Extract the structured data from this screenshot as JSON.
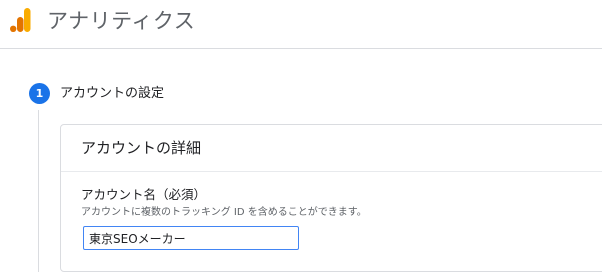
{
  "header": {
    "logo_icon": "google-analytics-logo",
    "app_title": "アナリティクス"
  },
  "step": {
    "number": "1",
    "title": "アカウントの設定"
  },
  "card": {
    "title": "アカウントの詳細",
    "field": {
      "label": "アカウント名（必須）",
      "help": "アカウントに複数のトラッキング ID を含めることができます。",
      "value": "東京SEOメーカー"
    }
  },
  "colors": {
    "accent": "#1a73e8",
    "logo_orange": "#f9ab00",
    "logo_dark_orange": "#e37400",
    "input_focus_border": "#4285f4"
  }
}
